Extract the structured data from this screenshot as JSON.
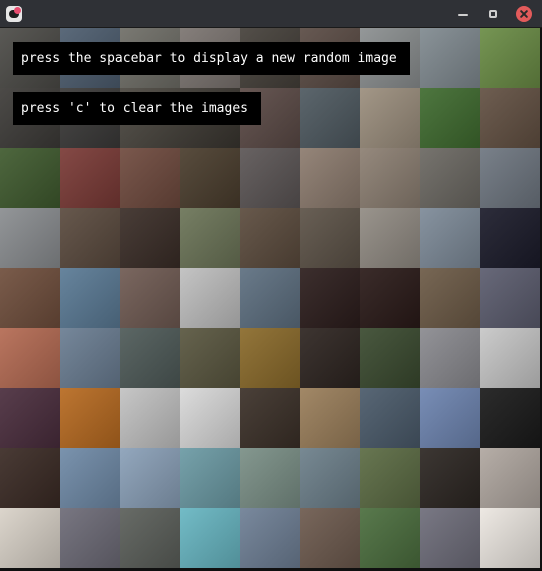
{
  "window": {
    "title": "",
    "app_icon": "app-icon",
    "buttons": [
      {
        "name": "minimize-icon",
        "color": "#cfcfcf"
      },
      {
        "name": "maximize-icon",
        "color": "#cfcfcf"
      },
      {
        "name": "close-icon",
        "color": "#e35b5b"
      }
    ]
  },
  "overlays": {
    "line1": "press the spacebar to display a new random image",
    "line2": "press 'c' to clear the images"
  },
  "tiles": [
    "#4c4b47",
    "#4d5d6f",
    "#6f6e67",
    "#7b7470",
    "#45403a",
    "#5a4b44",
    "#8b8f90",
    "#808a90",
    "#6a8c45",
    "#3d3b38",
    "#3b3a39",
    "#4b4740",
    "#3a3630",
    "#5b4a46",
    "#4e5960",
    "#9b8e7d",
    "#3f6b2f",
    "#625042",
    "#3f5a2e",
    "#7a3a36",
    "#6f4a3e",
    "#4a3d2d",
    "#5b5555",
    "#8c7b6e",
    "#8c7f72",
    "#6b6862",
    "#6e7680",
    "#8a8d90",
    "#5a4a3e",
    "#3a2d27",
    "#6b7457",
    "#5b4b3d",
    "#5c5247",
    "#918b83",
    "#7d8a98",
    "#1b1b2a",
    "#6f4e3c",
    "#5a7a95",
    "#6f5a52",
    "#bfbfbf",
    "#5d6f80",
    "#2c1d1c",
    "#2a1a18",
    "#6c5a46",
    "#5b5c6e",
    "#b46a52",
    "#6a7d92",
    "#4e5a58",
    "#59563f",
    "#8a6a2a",
    "#2d2420",
    "#3a4a2f",
    "#8a8a8f",
    "#c7c7c7",
    "#4a2d3d",
    "#b76a20",
    "#c2c2c2",
    "#d9d9d9",
    "#3b3028",
    "#9a7e5a",
    "#4a5a6a",
    "#6d84b0",
    "#1a1a1a",
    "#3a2a24",
    "#6f8aa7",
    "#8aa0b8",
    "#6b9aa4",
    "#7a8f86",
    "#6c7f8a",
    "#5b6b43",
    "#2c2622",
    "#b0a7a0",
    "#d9d2c8",
    "#6d6b77",
    "#5b5f5a",
    "#67b6c2",
    "#6e7f95",
    "#6d5a4e",
    "#4b6e3e",
    "#6e6d7a",
    "#ece7e1"
  ]
}
